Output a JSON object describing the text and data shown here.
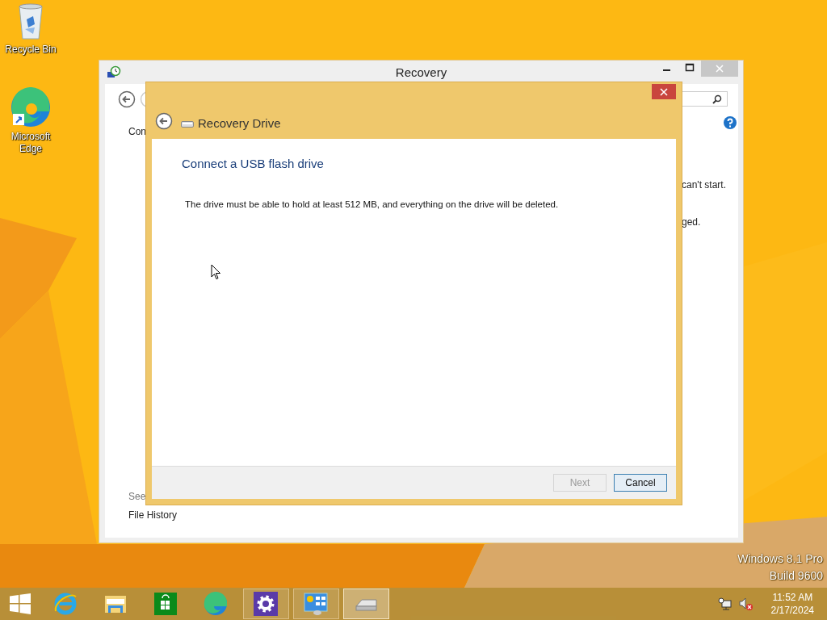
{
  "desktop_icons": [
    {
      "kind": "recycle_bin",
      "label": "Recycle Bin"
    },
    {
      "kind": "edge",
      "label": "Microsoft Edge"
    }
  ],
  "background_window": {
    "title": "Recovery",
    "intro": "Con",
    "line_1": "can't start.",
    "line_2": "ged.",
    "see_also": "See",
    "link": "File History"
  },
  "dialog": {
    "title": "Recovery Drive",
    "heading": "Connect a USB flash drive",
    "body": "The drive must be able to hold at least 512 MB, and everything on the drive will be deleted.",
    "buttons": [
      {
        "label": "Next",
        "disabled": true,
        "default": false
      },
      {
        "label": "Cancel",
        "disabled": false,
        "default": true
      }
    ]
  },
  "watermark": {
    "edition": "Windows 8.1 Pro",
    "build": "Build 9600"
  },
  "taskbar": {
    "apps": [
      {
        "kind": "ie",
        "running": false,
        "selected": false
      },
      {
        "kind": "explorer",
        "running": false,
        "selected": false
      },
      {
        "kind": "store",
        "running": false,
        "selected": false
      },
      {
        "kind": "edge",
        "running": false,
        "selected": false
      },
      {
        "kind": "settings",
        "running": true,
        "selected": false
      },
      {
        "kind": "control_panel",
        "running": true,
        "selected": false
      },
      {
        "kind": "recovery_drive",
        "running": true,
        "selected": true
      }
    ],
    "time": "11:52 AM",
    "date": "2/17/2024"
  }
}
